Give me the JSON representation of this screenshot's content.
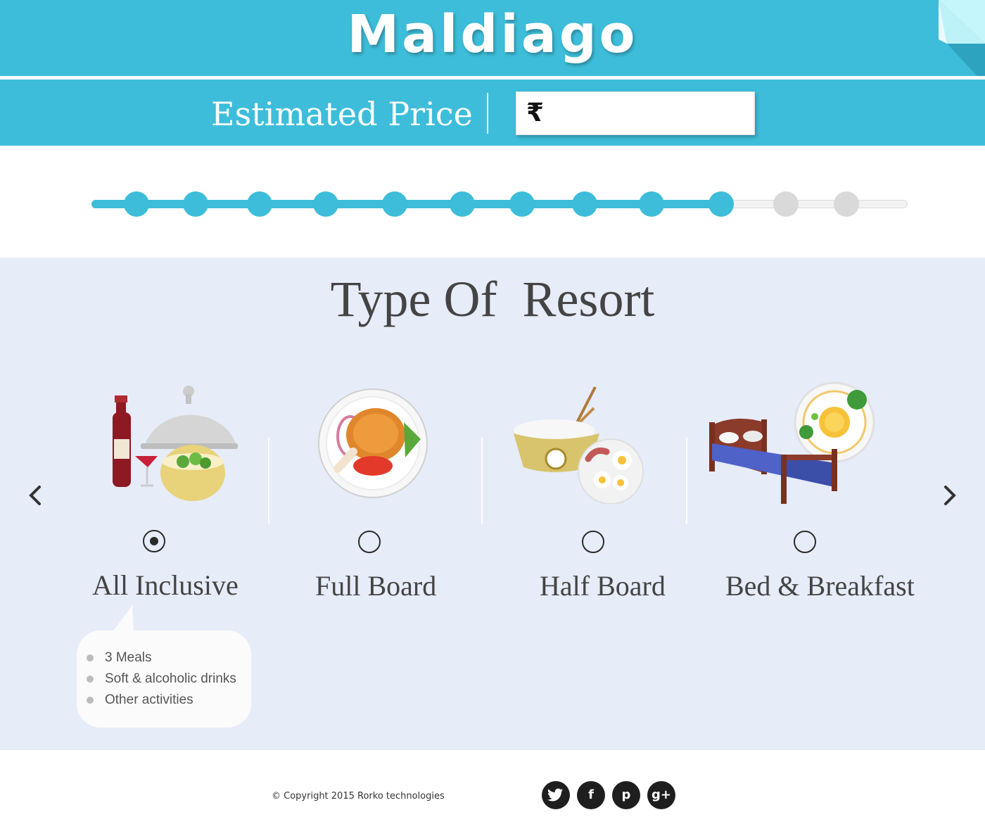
{
  "app": {
    "title": "Maldiago"
  },
  "price": {
    "label": "Estimated Price",
    "currency_symbol": "₹",
    "value": ""
  },
  "progress": {
    "total_steps": 12,
    "completed_steps": 10,
    "fill_fraction": 0.775
  },
  "section": {
    "title": "Type Of  Resort"
  },
  "navigation": {
    "prev_icon": "chevron-left-icon",
    "next_icon": "chevron-right-icon"
  },
  "options": [
    {
      "label": "All Inclusive",
      "selected": true,
      "icon": "wine-cloche-salad-icon"
    },
    {
      "label": "Full Board",
      "selected": false,
      "icon": "chicken-plate-icon"
    },
    {
      "label": "Half Board",
      "selected": false,
      "icon": "rice-bowl-eggs-icon"
    },
    {
      "label": "Bed & Breakfast",
      "selected": false,
      "icon": "bed-breakfast-icon"
    }
  ],
  "details": {
    "items": [
      "3 Meals",
      "Soft & alcoholic drinks",
      "Other activities"
    ]
  },
  "footer": {
    "copyright": "© Copyright 2015 Rorko technologies",
    "socials": [
      {
        "name": "twitter-icon",
        "glyph": "t"
      },
      {
        "name": "facebook-icon",
        "glyph": "f"
      },
      {
        "name": "pinterest-icon",
        "glyph": "p"
      },
      {
        "name": "google-plus-icon",
        "glyph": "g+"
      }
    ]
  },
  "colors": {
    "accent": "#3dbdd9",
    "panel": "#e6ecf8",
    "text": "#444444",
    "inactive": "#d9d9d9"
  }
}
